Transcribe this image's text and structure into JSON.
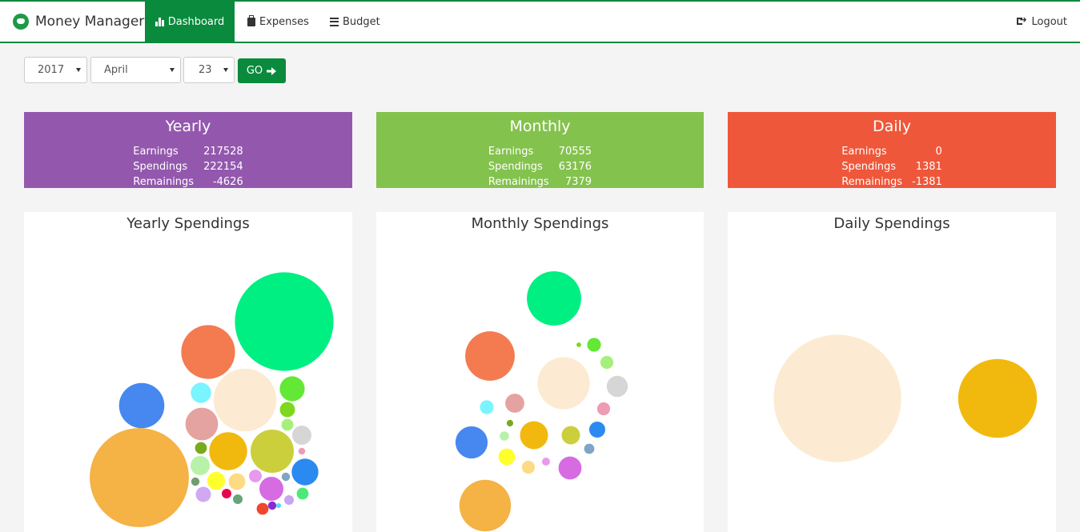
{
  "brand": "Money Manager",
  "nav": {
    "dashboard": "Dashboard",
    "expenses": "Expenses",
    "budget": "Budget",
    "logout": "Logout"
  },
  "filters": {
    "year": "2017",
    "month": "April",
    "day": "23",
    "go": "GO"
  },
  "summary": [
    {
      "title": "Yearly",
      "earnings_label": "Earnings",
      "earnings": "217528",
      "spendings_label": "Spendings",
      "spendings": "222154",
      "remainings_label": "Remainings",
      "remainings": "-4626",
      "color": "#9358ae"
    },
    {
      "title": "Monthly",
      "earnings_label": "Earnings",
      "earnings": "70555",
      "spendings_label": "Spendings",
      "spendings": "63176",
      "remainings_label": "Remainings",
      "remainings": "7379",
      "color": "#84c24e"
    },
    {
      "title": "Daily",
      "earnings_label": "Earnings",
      "earnings": "0",
      "spendings_label": "Spendings",
      "spendings": "1381",
      "remainings_label": "Remainings",
      "remainings": "-1381",
      "color": "#ef573a"
    }
  ],
  "chart_data": [
    {
      "type": "bubble",
      "title": "Yearly Spendings",
      "bubbles": [
        {
          "value": 4200,
          "color": "#00ef82"
        },
        {
          "value": 4250,
          "color": "#f5b245"
        },
        {
          "value": 1250,
          "color": "#f47a50"
        },
        {
          "value": 1700,
          "color": "#fcebd2"
        },
        {
          "value": 890,
          "color": "#4688f0"
        },
        {
          "value": 180,
          "color": "#7af4ff"
        },
        {
          "value": 460,
          "color": "#e4a3a0"
        },
        {
          "value": 270,
          "color": "#62e835"
        },
        {
          "value": 100,
          "color": "#7ed820"
        },
        {
          "value": 60,
          "color": "#a6ef7c"
        },
        {
          "value": 160,
          "color": "#d6d6d6"
        },
        {
          "value": 20,
          "color": "#ef9bb3"
        },
        {
          "value": 620,
          "color": "#f1b90e"
        },
        {
          "value": 810,
          "color": "#cccf3c"
        },
        {
          "value": 310,
          "color": "#2b8af0"
        },
        {
          "value": 60,
          "color": "#78ab1c"
        },
        {
          "value": 160,
          "color": "#b8f2a8"
        },
        {
          "value": 140,
          "color": "#ffff2e"
        },
        {
          "value": 120,
          "color": "#fddb84"
        },
        {
          "value": 250,
          "color": "#d66be2"
        },
        {
          "value": 70,
          "color": "#e799ef"
        },
        {
          "value": 100,
          "color": "#d0a9f2"
        },
        {
          "value": 40,
          "color": "#e6064f"
        },
        {
          "value": 40,
          "color": "#69a37c"
        },
        {
          "value": 60,
          "color": "#f0462c"
        },
        {
          "value": 60,
          "color": "#4de87a"
        },
        {
          "value": 40,
          "color": "#c7a5ef"
        },
        {
          "value": 30,
          "color": "#6f9e6e"
        },
        {
          "value": 30,
          "color": "#8a2bd0"
        },
        {
          "value": 30,
          "color": "#7fa4c6"
        },
        {
          "value": 10,
          "color": "#55d4ff"
        }
      ]
    },
    {
      "type": "bubble",
      "title": "Monthly Spendings",
      "bubbles": [
        {
          "value": 1390,
          "color": "#00ef82"
        },
        {
          "value": 1150,
          "color": "#f47a50"
        },
        {
          "value": 1280,
          "color": "#fcebd2"
        },
        {
          "value": 1250,
          "color": "#f5b245"
        },
        {
          "value": 490,
          "color": "#4688f0"
        },
        {
          "value": 90,
          "color": "#7af4ff"
        },
        {
          "value": 170,
          "color": "#e4a3a0"
        },
        {
          "value": 90,
          "color": "#62e835"
        },
        {
          "value": 80,
          "color": "#a6ef7c"
        },
        {
          "value": 210,
          "color": "#d6d6d6"
        },
        {
          "value": 80,
          "color": "#ef9bb3"
        },
        {
          "value": 370,
          "color": "#f1b90e"
        },
        {
          "value": 160,
          "color": "#cccf3c"
        },
        {
          "value": 120,
          "color": "#2b8af0"
        },
        {
          "value": 130,
          "color": "#ffff2e"
        },
        {
          "value": 80,
          "color": "#fddb84"
        },
        {
          "value": 250,
          "color": "#d66be2"
        },
        {
          "value": 50,
          "color": "#7fa4c6"
        },
        {
          "value": 40,
          "color": "#b8f2a8"
        },
        {
          "value": 20,
          "color": "#78ab1c"
        },
        {
          "value": 30,
          "color": "#e799ef"
        },
        {
          "value": 10,
          "color": "#7ed820"
        }
      ]
    },
    {
      "type": "bubble",
      "title": "Daily Spendings",
      "bubbles": [
        {
          "value": 1000,
          "color": "#fcebd2"
        },
        {
          "value": 381,
          "color": "#f1b90e"
        }
      ]
    }
  ]
}
